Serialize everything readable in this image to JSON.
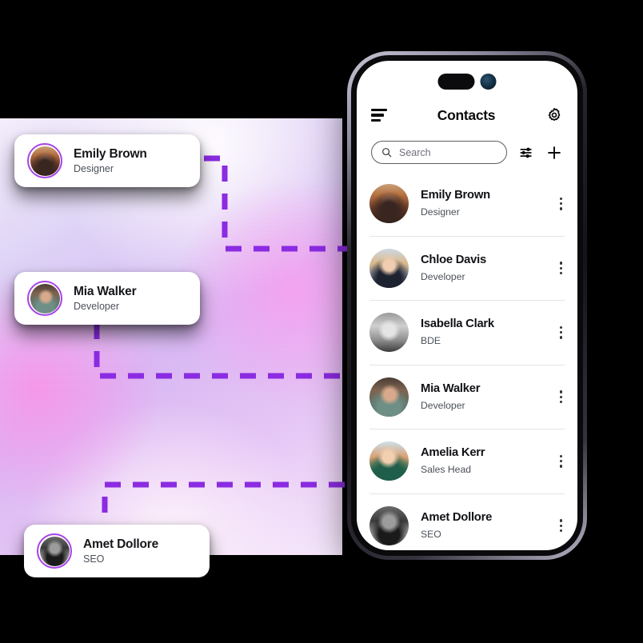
{
  "phone": {
    "status_bar": {
      "dynamic_island": "dynamic-island"
    },
    "header": {
      "menu_icon": "hamburger-menu-icon",
      "title": "Contacts",
      "settings_icon": "gear-icon"
    },
    "search": {
      "icon": "search-icon",
      "placeholder": "Search",
      "value": "",
      "filter_icon": "filter-sliders-icon",
      "add_icon": "plus-icon"
    },
    "contacts": [
      {
        "name": "Emily Brown",
        "role": "Designer",
        "avatar": "p-emily",
        "menu_icon": "kebab-menu-icon"
      },
      {
        "name": "Chloe Davis",
        "role": "Developer",
        "avatar": "p-chloe",
        "menu_icon": "kebab-menu-icon"
      },
      {
        "name": "Isabella Clark",
        "role": "BDE",
        "avatar": "p-isabella",
        "menu_icon": "kebab-menu-icon"
      },
      {
        "name": "Mia Walker",
        "role": "Developer",
        "avatar": "p-mia",
        "menu_icon": "kebab-menu-icon"
      },
      {
        "name": "Amelia Kerr",
        "role": "Sales Head",
        "avatar": "p-amelia",
        "menu_icon": "kebab-menu-icon"
      },
      {
        "name": "Amet Dollore",
        "role": "SEO",
        "avatar": "p-amet",
        "menu_icon": "kebab-menu-icon"
      }
    ]
  },
  "floating_cards": [
    {
      "name": "Emily Brown",
      "role": "Designer",
      "avatar": "p-emily"
    },
    {
      "name": "Mia Walker",
      "role": "Developer",
      "avatar": "p-mia"
    },
    {
      "name": "Amet Dollore",
      "role": "SEO",
      "avatar": "p-amet"
    }
  ],
  "colors": {
    "accent_purple": "#8B2BE2",
    "avatar_ring": "#A742E8",
    "background": "#000000",
    "card_surface": "#FFFFFF",
    "divider": "#E3E4E7",
    "text_primary": "#111216",
    "text_secondary": "#4B5058"
  }
}
